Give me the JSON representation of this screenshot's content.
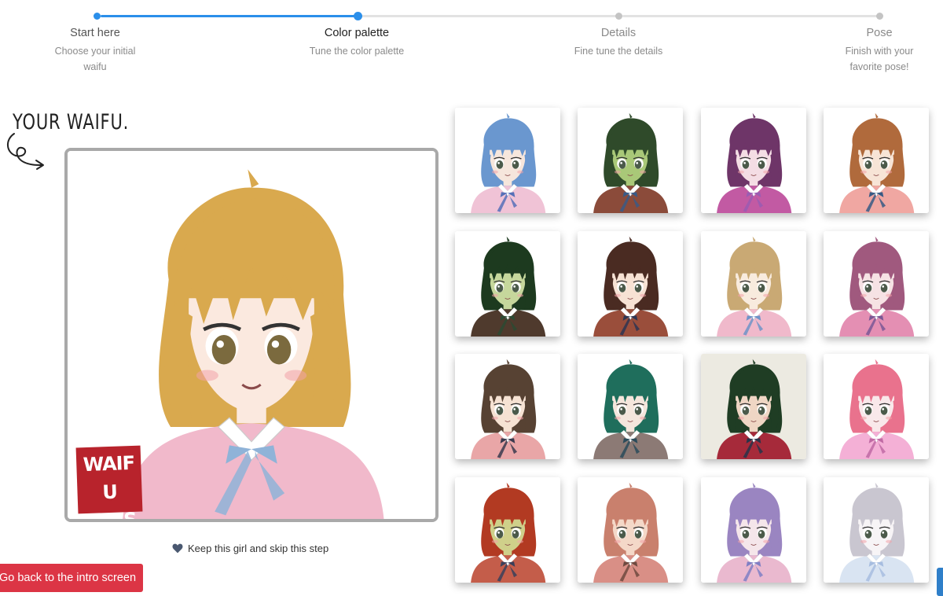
{
  "stepper": {
    "steps": [
      {
        "title": "Start here",
        "description": "Choose your initial waifu",
        "state": "done"
      },
      {
        "title": "Color palette",
        "description": "Tune the color palette",
        "state": "active"
      },
      {
        "title": "Details",
        "description": "Fine tune the details",
        "state": "pending"
      },
      {
        "title": "Pose",
        "description": "Finish with your favorite pose!",
        "state": "pending"
      }
    ],
    "colors": {
      "active": "#2b8fea",
      "inactive": "#e2e2e2",
      "dot_inactive": "#c4c4c4"
    }
  },
  "preview": {
    "heading": "YOUR WAIFU.",
    "watermark": "WAIFU LABS",
    "hair_color": "#d9a94e",
    "shirt_color": "#f1b9cb",
    "ribbon_color": "#8fb3d8",
    "eye_color": "#7b6a3e"
  },
  "actions": {
    "keep_label": "Keep this girl and skip this step",
    "back_label": "Go back to the intro screen",
    "back_color": "#dc3545"
  },
  "grid": {
    "tiles": [
      {
        "hair": "#6a97cf",
        "skin": "#f6e6dc",
        "shirt": "#f0c3d6",
        "ribbon": "#5670b8",
        "bg": "#ffffff"
      },
      {
        "hair": "#2f4a2a",
        "skin": "#a9c878",
        "shirt": "#8b4b3a",
        "ribbon": "#395a86",
        "bg": "#ffffff"
      },
      {
        "hair": "#6e3568",
        "skin": "#f4dde4",
        "shirt": "#c25aa3",
        "ribbon": "#9a5cb3",
        "bg": "#ffffff"
      },
      {
        "hair": "#b06a3c",
        "skin": "#f7e4d6",
        "shirt": "#f0a7a2",
        "ribbon": "#375a85",
        "bg": "#ffffff"
      },
      {
        "hair": "#1d3a1f",
        "skin": "#c6d79c",
        "shirt": "#4f3a2d",
        "ribbon": "#2c4a33",
        "bg": "#ffffff"
      },
      {
        "hair": "#4a2b22",
        "skin": "#f7e2d4",
        "shirt": "#9a4e3b",
        "ribbon": "#2e3552",
        "bg": "#ffffff"
      },
      {
        "hair": "#c9a974",
        "skin": "#f8ebde",
        "shirt": "#f0b9cb",
        "ribbon": "#6f93c8",
        "bg": "#ffffff"
      },
      {
        "hair": "#a0597e",
        "skin": "#f6e2e4",
        "shirt": "#e48fb3",
        "ribbon": "#7a5895",
        "bg": "#ffffff"
      },
      {
        "hair": "#574233",
        "skin": "#f6e2d3",
        "shirt": "#e9a6a7",
        "ribbon": "#3a3a4e",
        "bg": "#ffffff"
      },
      {
        "hair": "#1f6e5c",
        "skin": "#f4e6dc",
        "shirt": "#8c7a75",
        "ribbon": "#2a4b5a",
        "bg": "#ffffff"
      },
      {
        "hair": "#1f3d24",
        "skin": "#efd6c4",
        "shirt": "#a62a3a",
        "ribbon": "#27344a",
        "bg": "#eceae1"
      },
      {
        "hair": "#e9728d",
        "skin": "#f9e8ea",
        "shirt": "#f4b0d6",
        "ribbon": "#c06aa4",
        "bg": "#ffffff"
      },
      {
        "hair": "#b23a22",
        "skin": "#cfd08a",
        "shirt": "#c45d4a",
        "ribbon": "#3a3f5a",
        "bg": "#ffffff"
      },
      {
        "hair": "#c9806d",
        "skin": "#f4d8c8",
        "shirt": "#d98f86",
        "ribbon": "#6e4a40",
        "bg": "#ffffff"
      },
      {
        "hair": "#9a85c1",
        "skin": "#f5e6ea",
        "shirt": "#eab9cf",
        "ribbon": "#7f7fc4",
        "bg": "#ffffff"
      },
      {
        "hair": "#c9c6d0",
        "skin": "#f7f4f6",
        "shirt": "#d9e4f2",
        "ribbon": "#a7bde0",
        "bg": "#ffffff"
      }
    ]
  }
}
